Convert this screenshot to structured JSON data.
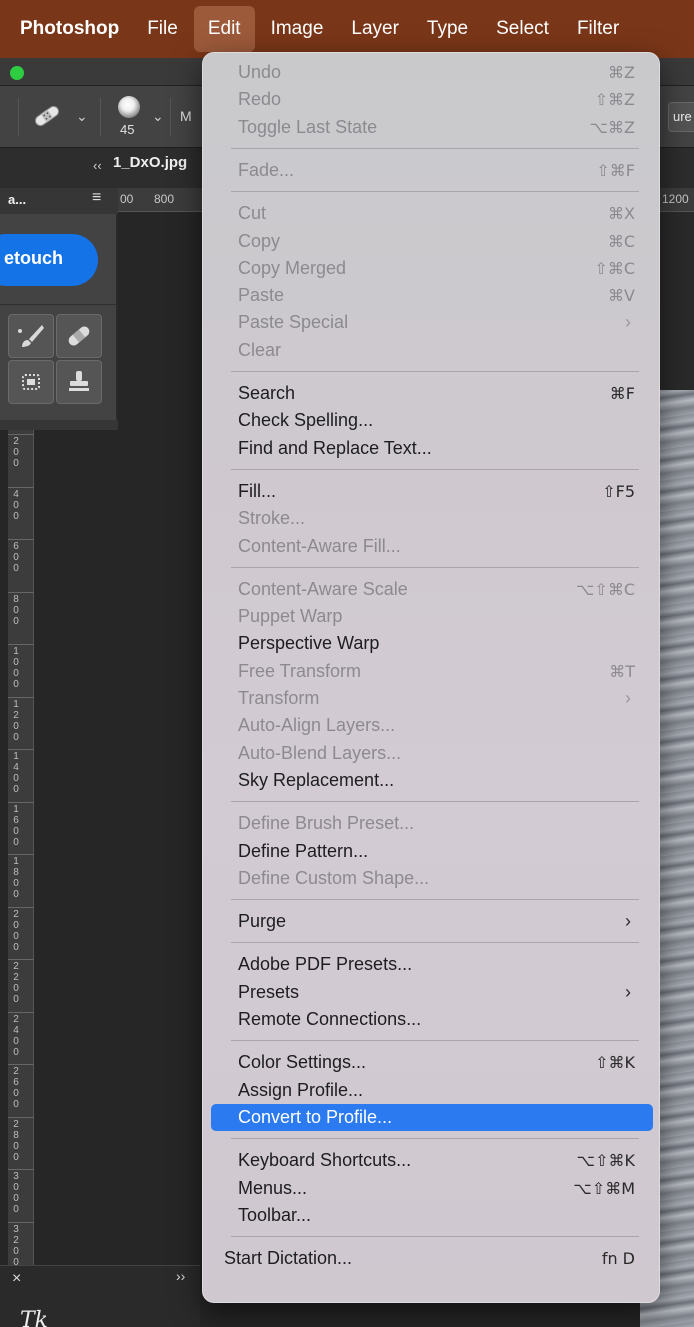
{
  "menubar": {
    "items": [
      "Photoshop",
      "File",
      "Edit",
      "Image",
      "Layer",
      "Type",
      "Select",
      "Filter"
    ],
    "active": "Edit"
  },
  "options_bar": {
    "brush_size": "45",
    "mode_partial": "M",
    "right_partial": "ure"
  },
  "document": {
    "collapse_glyph": "‹‹",
    "title": "1_DxO.jpg"
  },
  "ruler": {
    "left_partial": "00",
    "mark_800": "800",
    "mark_1200": "1200"
  },
  "tools_panel": {
    "tab_label": "a...",
    "menu_glyph": "≡",
    "retouch_label": "etouch"
  },
  "vertical_ruler": {
    "labels": [
      "2\n0\n0",
      "4\n0\n0",
      "6\n0\n0",
      "8\n0\n0",
      "1\n0\n0\n0",
      "1\n2\n0\n0",
      "1\n4\n0\n0",
      "1\n6\n0\n0",
      "1\n8\n0\n0",
      "2\n0\n0\n0",
      "2\n2\n0\n0",
      "2\n4\n0\n0",
      "2\n6\n0\n0",
      "2\n8\n0\n0",
      "3\n0\n0\n0",
      "3\n2\n0\n0"
    ]
  },
  "bottom_panel": {
    "close_glyph": "×",
    "expand_glyph": "››",
    "logo_text": "Tk"
  },
  "edit_menu": {
    "groups": [
      [
        {
          "label": "Undo",
          "shortcut": "⌘Z",
          "disabled": true
        },
        {
          "label": "Redo",
          "shortcut": "⇧⌘Z",
          "disabled": true
        },
        {
          "label": "Toggle Last State",
          "shortcut": "⌥⌘Z",
          "disabled": true
        }
      ],
      [
        {
          "label": "Fade...",
          "shortcut": "⇧⌘F",
          "disabled": true
        }
      ],
      [
        {
          "label": "Cut",
          "shortcut": "⌘X",
          "disabled": true
        },
        {
          "label": "Copy",
          "shortcut": "⌘C",
          "disabled": true
        },
        {
          "label": "Copy Merged",
          "shortcut": "⇧⌘C",
          "disabled": true
        },
        {
          "label": "Paste",
          "shortcut": "⌘V",
          "disabled": true
        },
        {
          "label": "Paste Special",
          "submenu": true,
          "disabled": true
        },
        {
          "label": "Clear",
          "disabled": true
        }
      ],
      [
        {
          "label": "Search",
          "shortcut": "⌘F",
          "disabled": false
        },
        {
          "label": "Check Spelling...",
          "disabled": false
        },
        {
          "label": "Find and Replace Text...",
          "disabled": false
        }
      ],
      [
        {
          "label": "Fill...",
          "shortcut": "⇧F5",
          "disabled": false
        },
        {
          "label": "Stroke...",
          "disabled": true
        },
        {
          "label": "Content-Aware Fill...",
          "disabled": true
        }
      ],
      [
        {
          "label": "Content-Aware Scale",
          "shortcut": "⌥⇧⌘C",
          "disabled": true
        },
        {
          "label": "Puppet Warp",
          "disabled": true
        },
        {
          "label": "Perspective Warp",
          "disabled": false
        },
        {
          "label": "Free Transform",
          "shortcut": "⌘T",
          "disabled": true
        },
        {
          "label": "Transform",
          "submenu": true,
          "disabled": true
        },
        {
          "label": "Auto-Align Layers...",
          "disabled": true
        },
        {
          "label": "Auto-Blend Layers...",
          "disabled": true
        },
        {
          "label": "Sky Replacement...",
          "disabled": false
        }
      ],
      [
        {
          "label": "Define Brush Preset...",
          "disabled": true
        },
        {
          "label": "Define Pattern...",
          "disabled": false
        },
        {
          "label": "Define Custom Shape...",
          "disabled": true
        }
      ],
      [
        {
          "label": "Purge",
          "submenu": true,
          "disabled": false
        }
      ],
      [
        {
          "label": "Adobe PDF Presets...",
          "disabled": false
        },
        {
          "label": "Presets",
          "submenu": true,
          "disabled": false
        },
        {
          "label": "Remote Connections...",
          "disabled": false
        }
      ],
      [
        {
          "label": "Color Settings...",
          "shortcut": "⇧⌘K",
          "disabled": false
        },
        {
          "label": "Assign Profile...",
          "disabled": false
        },
        {
          "label": "Convert to Profile...",
          "disabled": false,
          "selected": true
        }
      ],
      [
        {
          "label": "Keyboard Shortcuts...",
          "shortcut": "⌥⇧⌘K",
          "disabled": false
        },
        {
          "label": "Menus...",
          "shortcut": "⌥⇧⌘M",
          "disabled": false
        },
        {
          "label": "Toolbar...",
          "disabled": false
        }
      ],
      [
        {
          "label": "Start Dictation...",
          "shortcut": "fn D",
          "disabled": false,
          "start": true
        }
      ]
    ]
  },
  "colors": {
    "menubar_bg": "#7a3618",
    "selection": "#2b7af0",
    "retouch_button": "#1473e6"
  }
}
